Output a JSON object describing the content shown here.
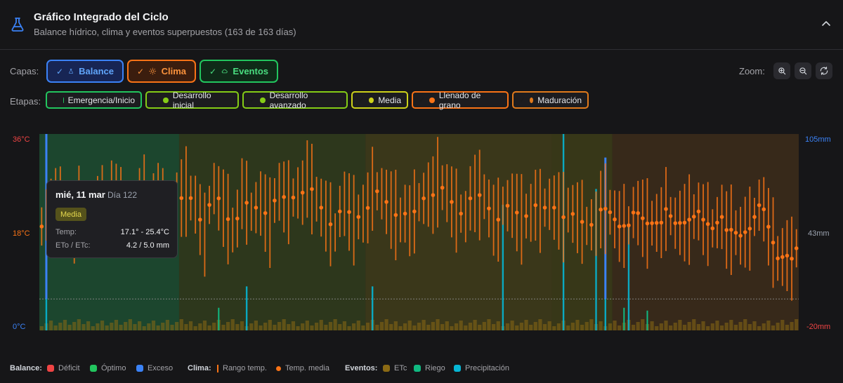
{
  "header": {
    "title": "Gráfico Integrado del Ciclo",
    "subtitle": "Balance hídrico, clima y eventos superpuestos (163 de 163 días)"
  },
  "controls": {
    "layers_label": "Capas:",
    "layers": [
      {
        "check": "✓",
        "label": "Balance",
        "color": "#3b82f6",
        "text": "#60a5fa",
        "bg": "#172554"
      },
      {
        "check": "✓",
        "label": "Clima",
        "color": "#f97316",
        "text": "#fb923c",
        "bg": "#3b1d0e"
      },
      {
        "check": "✓",
        "label": "Eventos",
        "color": "#22c55e",
        "text": "#4ade80",
        "bg": "#0f2a18"
      }
    ],
    "zoom_label": "Zoom:",
    "stages_label": "Etapas:",
    "stages": [
      {
        "check": "✓",
        "label": "Emergencia/Inicio",
        "color": "#22c55e"
      },
      {
        "check": "✓",
        "label": "Desarrollo inicial",
        "color": "#84cc16"
      },
      {
        "check": "✓",
        "label": "Desarrollo avanzado",
        "color": "#84cc16"
      },
      {
        "check": "✓",
        "label": "Media",
        "color": "#cdd21a"
      },
      {
        "check": "✓",
        "label": "Llenado de grano",
        "color": "#f97316"
      },
      {
        "check": "✓",
        "label": "Maduración",
        "color": "#e07a1c"
      }
    ]
  },
  "axes": {
    "left_top": "36°C",
    "left_mid": "18°C",
    "left_bottom": "0°C",
    "right_top": "105mm",
    "right_mid": "43mm",
    "right_bottom": "-20mm",
    "left_color": "#ef4444",
    "left_mid_color": "#f97316",
    "left_bottom_color": "#3b82f6",
    "right_top_color": "#3b82f6",
    "right_mid_color": "#9ca3af",
    "right_bottom_color": "#ef4444"
  },
  "tooltip": {
    "date": "mié, 11 mar",
    "day": "Día 122",
    "stage": "Media",
    "temp_label": "Temp:",
    "temp_value": "17.1° - 25.4°C",
    "et_label": "ETo / ETc:",
    "et_value": "4.2 / 5.0 mm"
  },
  "legend": {
    "balance_title": "Balance:",
    "deficit": "Déficit",
    "optimo": "Óptimo",
    "exceso": "Exceso",
    "clima_title": "Clima:",
    "rango": "Rango temp.",
    "media": "Temp. media",
    "eventos_title": "Eventos:",
    "etc": "ETc",
    "riego": "Riego",
    "precip": "Precipitación",
    "colors": {
      "deficit": "#ef4444",
      "optimo": "#22c55e",
      "exceso": "#3b82f6",
      "temp": "#f97316",
      "etc": "#8b6a14",
      "riego": "#10b981",
      "precip": "#06b6d4"
    }
  },
  "chart_data": {
    "type": "line",
    "days": 163,
    "ylim_temp": [
      0,
      36
    ],
    "ylim_water": [
      -20,
      105
    ],
    "stages": [
      {
        "name": "Emergencia/Inicio",
        "start": 0,
        "end": 29,
        "color": "#1c4a30"
      },
      {
        "name": "Desarrollo inicial",
        "start": 30,
        "end": 69,
        "color": "#2f3a1c"
      },
      {
        "name": "Desarrollo avanzado",
        "start": 70,
        "end": 109,
        "color": "#3d3a1a"
      },
      {
        "name": "Media",
        "start": 110,
        "end": 122,
        "color": "#3a3a17"
      },
      {
        "name": "Llenado de grano",
        "start": 123,
        "end": 162,
        "color": "#3a2a1a"
      }
    ],
    "temp_mean": [
      [
        1,
        20.1
      ],
      [
        3,
        22.3
      ],
      [
        5,
        21.2
      ],
      [
        7,
        19.8
      ],
      [
        9,
        23.1
      ],
      [
        11,
        20.4
      ],
      [
        13,
        22.7
      ],
      [
        15,
        24.8
      ],
      [
        17,
        21.9
      ],
      [
        19,
        20.3
      ],
      [
        21,
        23.7
      ],
      [
        23,
        22.1
      ],
      [
        25,
        24.2
      ],
      [
        27,
        20.6
      ],
      [
        29,
        22.0
      ],
      [
        31,
        25.1
      ],
      [
        33,
        23.4
      ],
      [
        35,
        18.6
      ],
      [
        37,
        25.3
      ],
      [
        39,
        22.4
      ],
      [
        41,
        19.1
      ],
      [
        43,
        24.0
      ],
      [
        45,
        21.4
      ],
      [
        47,
        23.6
      ],
      [
        49,
        20.8
      ],
      [
        51,
        24.7
      ],
      [
        53,
        23.5
      ],
      [
        55,
        25.9
      ],
      [
        57,
        26.7
      ],
      [
        59,
        23.7
      ],
      [
        61,
        21.3
      ],
      [
        63,
        19.0
      ],
      [
        65,
        22.5
      ],
      [
        67,
        20.2
      ],
      [
        69,
        22.1
      ],
      [
        71,
        24.9
      ],
      [
        73,
        24.7
      ],
      [
        75,
        22.4
      ],
      [
        77,
        21.3
      ],
      [
        79,
        19.4
      ],
      [
        81,
        23.5
      ],
      [
        83,
        25.6
      ],
      [
        85,
        26.1
      ],
      [
        87,
        24.8
      ],
      [
        89,
        22.3
      ],
      [
        91,
        21.9
      ],
      [
        93,
        24.4
      ],
      [
        95,
        24.5
      ],
      [
        97,
        20.9
      ],
      [
        99,
        21.8
      ],
      [
        101,
        22.5
      ],
      [
        103,
        20.7
      ],
      [
        105,
        22.6
      ],
      [
        107,
        21.2
      ],
      [
        109,
        23.1
      ],
      [
        111,
        22.6
      ],
      [
        113,
        21.0
      ],
      [
        115,
        20.3
      ],
      [
        117,
        19.5
      ],
      [
        119,
        20.6
      ],
      [
        121,
        21.6
      ],
      [
        122,
        21.3
      ],
      [
        124,
        19.4
      ],
      [
        126,
        20.3
      ],
      [
        128,
        20.8
      ],
      [
        130,
        19.6
      ],
      [
        132,
        20.4
      ],
      [
        134,
        21.2
      ],
      [
        136,
        19.3
      ],
      [
        138,
        20.1
      ],
      [
        140,
        21.9
      ],
      [
        142,
        19.6
      ],
      [
        144,
        18.7
      ],
      [
        146,
        21.5
      ],
      [
        148,
        17.4
      ],
      [
        150,
        17.0
      ],
      [
        152,
        19.0
      ],
      [
        154,
        24.0
      ],
      [
        156,
        18.3
      ],
      [
        158,
        13.2
      ],
      [
        160,
        14.4
      ],
      [
        162,
        14.0
      ]
    ],
    "temp_range_days": 163,
    "precipitation": [
      {
        "day": 1,
        "mm": 105
      },
      {
        "day": 44,
        "mm": 8
      },
      {
        "day": 71,
        "mm": 8
      },
      {
        "day": 99,
        "mm": 60
      },
      {
        "day": 112,
        "mm": 105
      },
      {
        "day": 119,
        "mm": 70
      },
      {
        "day": 126,
        "mm": 48
      },
      {
        "day": 121,
        "mm": 28
      }
    ],
    "riego": [
      {
        "day": 38,
        "mm": 8
      },
      {
        "day": 125,
        "mm": 8
      },
      {
        "day": 130,
        "mm": 7
      }
    ],
    "balance_excess": [
      {
        "day": 1,
        "mm": 105
      },
      {
        "day": 121,
        "mm": 90
      }
    ],
    "optimal_line_mm": 0
  }
}
